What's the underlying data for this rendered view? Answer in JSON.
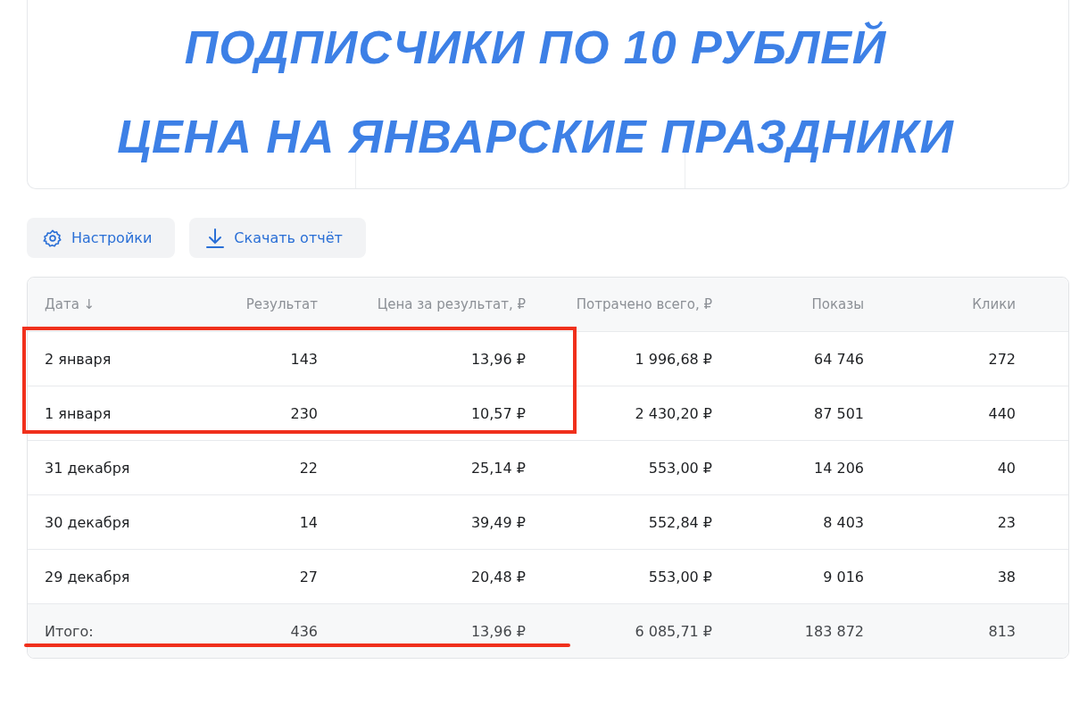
{
  "title_lines": [
    "ПОДПИСЧИКИ ПО 10 РУБЛЕЙ",
    "ЦЕНА НА ЯНВАРСКИЕ ПРАЗДНИКИ"
  ],
  "buttons": [
    {
      "kind": "settings",
      "label": "Настройки"
    },
    {
      "kind": "download",
      "label": "Скачать отчёт"
    }
  ],
  "table": {
    "columns": [
      "Дата ↓",
      "Результат",
      "Цена за результат, ₽",
      "Потрачено всего, ₽",
      "Показы",
      "Клики"
    ],
    "rows": [
      [
        "2 января",
        "143",
        "13,96 ₽",
        "1 996,68 ₽",
        "64 746",
        "272"
      ],
      [
        "1 января",
        "230",
        "10,57 ₽",
        "2 430,20 ₽",
        "87 501",
        "440"
      ],
      [
        "31 декабря",
        "22",
        "25,14 ₽",
        "553,00 ₽",
        "14 206",
        "40"
      ],
      [
        "30 декабря",
        "14",
        "39,49 ₽",
        "552,84 ₽",
        "8 403",
        "23"
      ],
      [
        "29 декабря",
        "27",
        "20,48 ₽",
        "553,00 ₽",
        "9 016",
        "38"
      ]
    ],
    "total": [
      "Итого:",
      "436",
      "13,96 ₽",
      "6 085,71 ₽",
      "183 872",
      "813"
    ]
  }
}
